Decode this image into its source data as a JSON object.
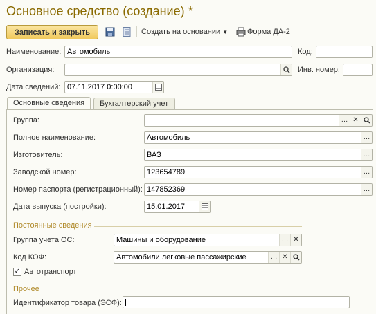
{
  "window": {
    "title": "Основное средство (создание) *"
  },
  "toolbar": {
    "save_close_label": "Записать и закрыть",
    "create_based_label": "Создать на основании",
    "form_label": "Форма ДА-2"
  },
  "header": {
    "name_label": "Наименование:",
    "name_value": "Автомобиль",
    "code_label": "Код:",
    "code_value": "",
    "org_label": "Организация:",
    "org_value": "",
    "inv_label": "Инв. номер:",
    "inv_value": "",
    "date_label": "Дата сведений:",
    "date_value": "07.11.2017  0:00:00"
  },
  "tabs": [
    {
      "label": "Основные сведения",
      "active": true
    },
    {
      "label": "Бухгалтерский учет",
      "active": false
    }
  ],
  "main": {
    "group_label": "Группа:",
    "group_value": "",
    "full_name_label": "Полное наименование:",
    "full_name_value": "Автомобиль",
    "manufacturer_label": "Изготовитель:",
    "manufacturer_value": "ВАЗ",
    "serial_label": "Заводской номер:",
    "serial_value": "123654789",
    "passport_label": "Номер паспорта (регистрационный):",
    "passport_value": "147852369",
    "release_date_label": "Дата выпуска (постройки):",
    "release_date_value": "15.01.2017"
  },
  "permanent": {
    "section_title": "Постоянные сведения",
    "os_group_label": "Группа учета ОС:",
    "os_group_value": "Машины и оборудование",
    "kof_label": "Код КОФ:",
    "kof_value": "Автомобили легковые пассажирские",
    "vehicle_label": "Автотранспорт",
    "vehicle_checked": true
  },
  "other": {
    "section_title": "Прочее",
    "product_id_label": "Идентификатор товара (ЭСФ):",
    "product_id_value": ""
  }
}
